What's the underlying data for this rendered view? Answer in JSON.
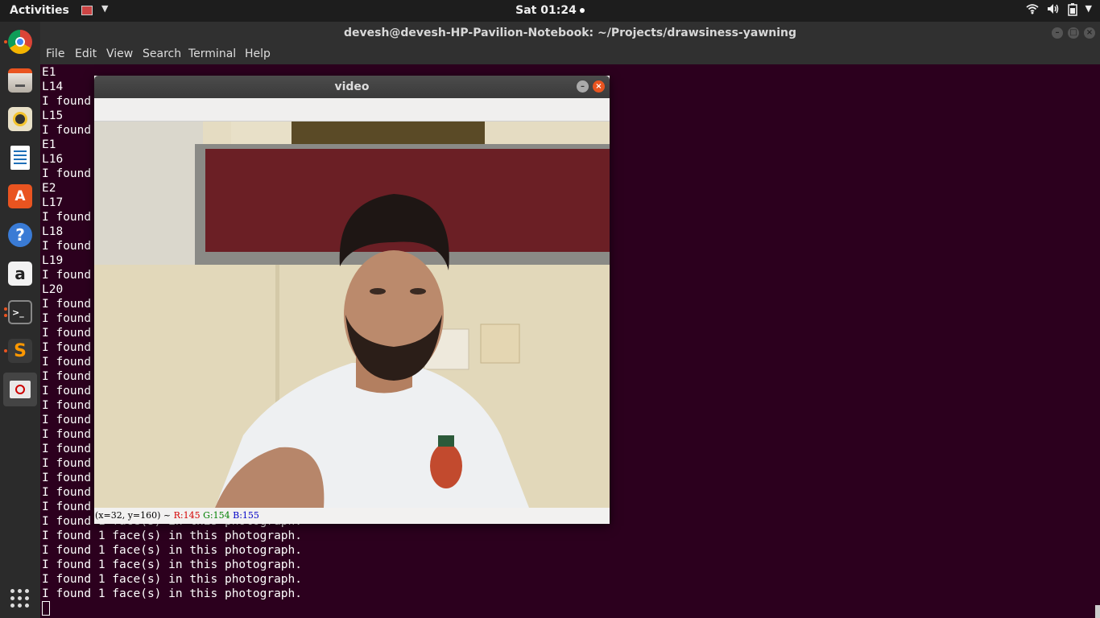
{
  "topbar": {
    "activities": "Activities",
    "clock": "Sat 01:24",
    "tray_icons": [
      "wifi-icon",
      "volume-icon",
      "battery-icon",
      "chevron-down-icon"
    ]
  },
  "dock": {
    "items": [
      {
        "name": "chrome",
        "label": "Google Chrome"
      },
      {
        "name": "files",
        "label": "Files"
      },
      {
        "name": "rhythmbox",
        "label": "Rhythmbox"
      },
      {
        "name": "writer",
        "label": "LibreOffice Writer"
      },
      {
        "name": "software",
        "label": "Ubuntu Software"
      },
      {
        "name": "help",
        "label": "Help"
      },
      {
        "name": "amazon",
        "label": "Amazon"
      },
      {
        "name": "terminal",
        "label": "Terminal"
      },
      {
        "name": "sublime",
        "label": "Sublime Text"
      },
      {
        "name": "opencv-window",
        "label": "video"
      }
    ]
  },
  "terminal": {
    "title": "devesh@devesh-HP-Pavilion-Notebook: ~/Projects/drawsiness-yawning",
    "menu": [
      "File",
      "Edit",
      "View",
      "Search",
      "Terminal",
      "Help"
    ],
    "lines": [
      "E1",
      "L14",
      "I found",
      "L15",
      "I found",
      "E1",
      "L16",
      "I found",
      "E2",
      "L17",
      "I found",
      "L18",
      "I found",
      "L19",
      "I found",
      "L20",
      "I found",
      "I found",
      "I found",
      "I found",
      "I found",
      "I found",
      "I found",
      "I found",
      "I found",
      "I found",
      "I found",
      "I found",
      "I found",
      "I found",
      "I found",
      "I found 1 face(s) in this photograph.",
      "I found 1 face(s) in this photograph.",
      "I found 1 face(s) in this photograph.",
      "I found 1 face(s) in this photograph.",
      "I found 1 face(s) in this photograph.",
      "I found 1 face(s) in this photograph."
    ]
  },
  "video_window": {
    "title": "video",
    "status": {
      "coords": "(x=32, y=160) ~",
      "r": "R:145",
      "g": "G:154",
      "b": "B:155"
    }
  }
}
